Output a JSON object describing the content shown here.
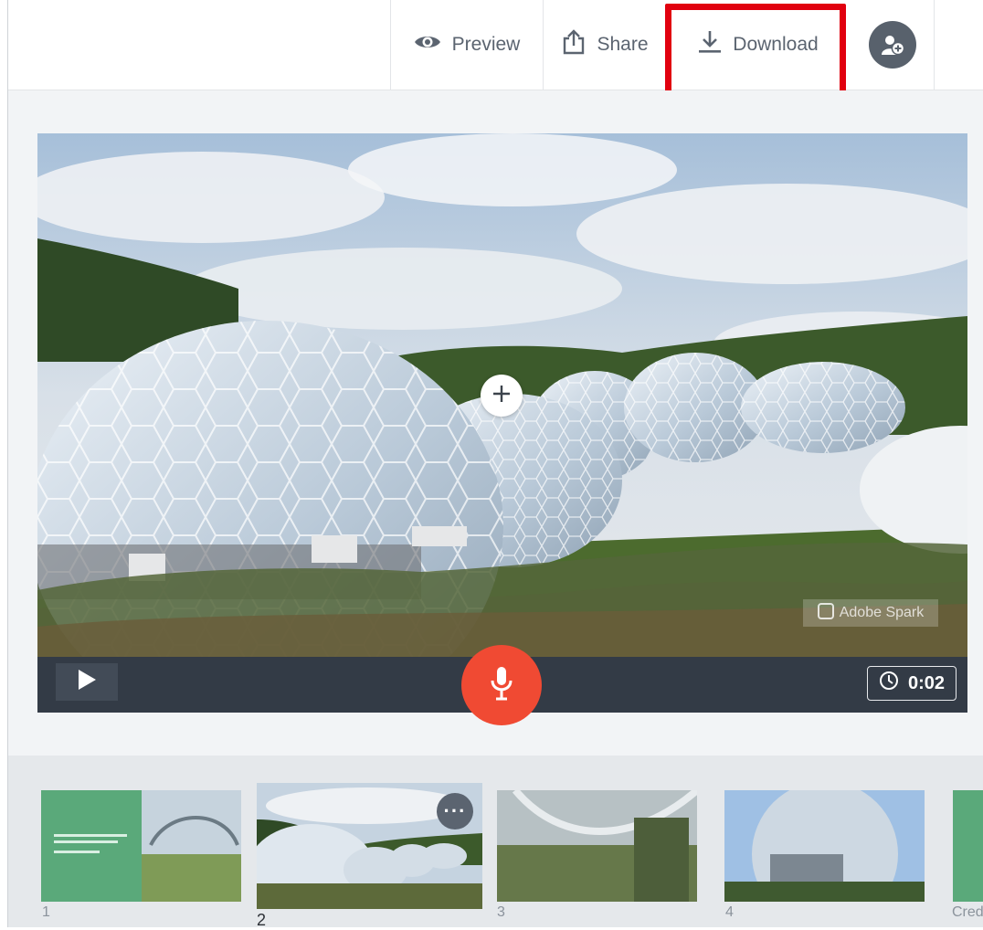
{
  "toolbar": {
    "preview_label": "Preview",
    "share_label": "Share",
    "download_label": "Download",
    "avatar_icon": "add-user-icon"
  },
  "player": {
    "duration": "0:02",
    "watermark": "Adobe Spark",
    "play_icon": "play-icon",
    "mic_icon": "microphone-icon",
    "add_icon": "plus-icon"
  },
  "filmstrip": {
    "thumbs": [
      {
        "number": "1"
      },
      {
        "number": "2"
      },
      {
        "number": "3"
      },
      {
        "number": "4"
      },
      {
        "number": "Cred"
      }
    ],
    "more_icon": "more-options-icon"
  },
  "colors": {
    "highlight": "#e1000f",
    "mic": "#f04a33",
    "controls_bg": "#333b46",
    "accent_green": "#5aa97a"
  }
}
